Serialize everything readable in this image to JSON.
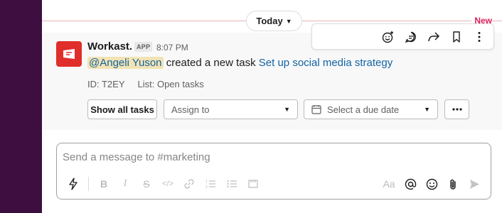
{
  "divider": {
    "day_label": "Today",
    "new_label": "New"
  },
  "message": {
    "sender": "Workast.",
    "badge": "APP",
    "time": "8:07 PM",
    "mention": "@Angeli Yuson",
    "text_middle": " created a new task ",
    "task_title": "Set up social media strategy",
    "task_id": "ID: T2EY",
    "task_list": "List: Open tasks",
    "show_all_label": "Show all tasks",
    "assign_placeholder": "Assign to",
    "due_placeholder": "Select a due date"
  },
  "composer": {
    "placeholder": "Send a message to #marketing",
    "font_size_label": "Aa"
  },
  "colors": {
    "sidebar": "#3f0e40",
    "new": "#e01e5a",
    "link": "#1264a3",
    "avatar": "#e02e2a"
  },
  "icons": {
    "toolbar": [
      "emoji-reaction-icon",
      "reply-thread-icon",
      "share-icon",
      "bookmark-icon",
      "more-icon"
    ],
    "composer_format": [
      "bold-icon",
      "italic-icon",
      "strikethrough-icon",
      "code-icon",
      "link-icon",
      "ordered-list-icon",
      "bullet-list-icon",
      "code-block-icon"
    ],
    "composer_right": [
      "mention-icon",
      "emoji-icon",
      "attach-icon",
      "send-icon"
    ]
  }
}
